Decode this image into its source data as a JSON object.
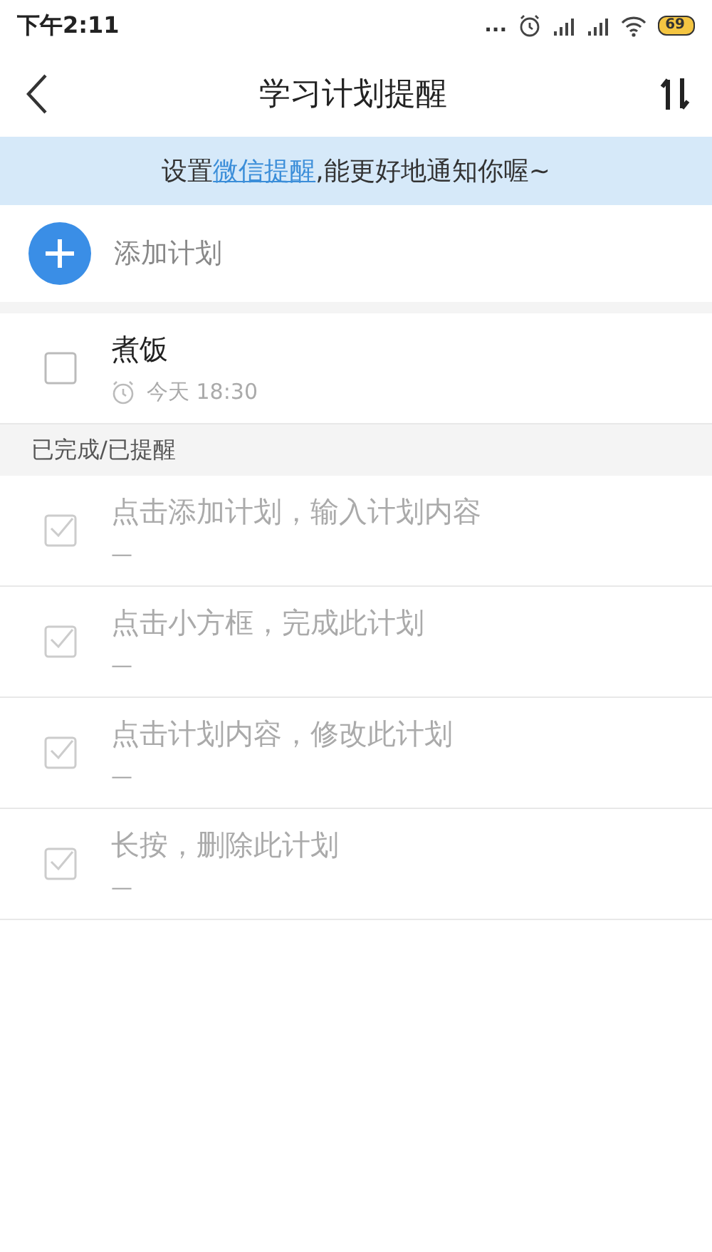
{
  "status_bar": {
    "time": "下午2:11",
    "dots": "...",
    "battery_text": "69"
  },
  "header": {
    "title": "学习计划提醒"
  },
  "banner": {
    "prefix": "设置",
    "link": "微信提醒",
    "suffix": ",能更好地通知你喔~"
  },
  "add_row": {
    "label": "添加计划"
  },
  "plans": [
    {
      "title": "煮饭",
      "reminder": "今天 18:30",
      "alarm": true,
      "checked": false
    }
  ],
  "done_section": {
    "title": "已完成/已提醒"
  },
  "done_plans": [
    {
      "title": "点击添加计划，输入计划内容",
      "reminder": "—",
      "alarm": false,
      "checked": true
    },
    {
      "title": "点击小方框，完成此计划",
      "reminder": "—",
      "alarm": false,
      "checked": true
    },
    {
      "title": "点击计划内容，修改此计划",
      "reminder": "—",
      "alarm": false,
      "checked": true
    },
    {
      "title": "长按，删除此计划",
      "reminder": "—",
      "alarm": false,
      "checked": true
    }
  ]
}
